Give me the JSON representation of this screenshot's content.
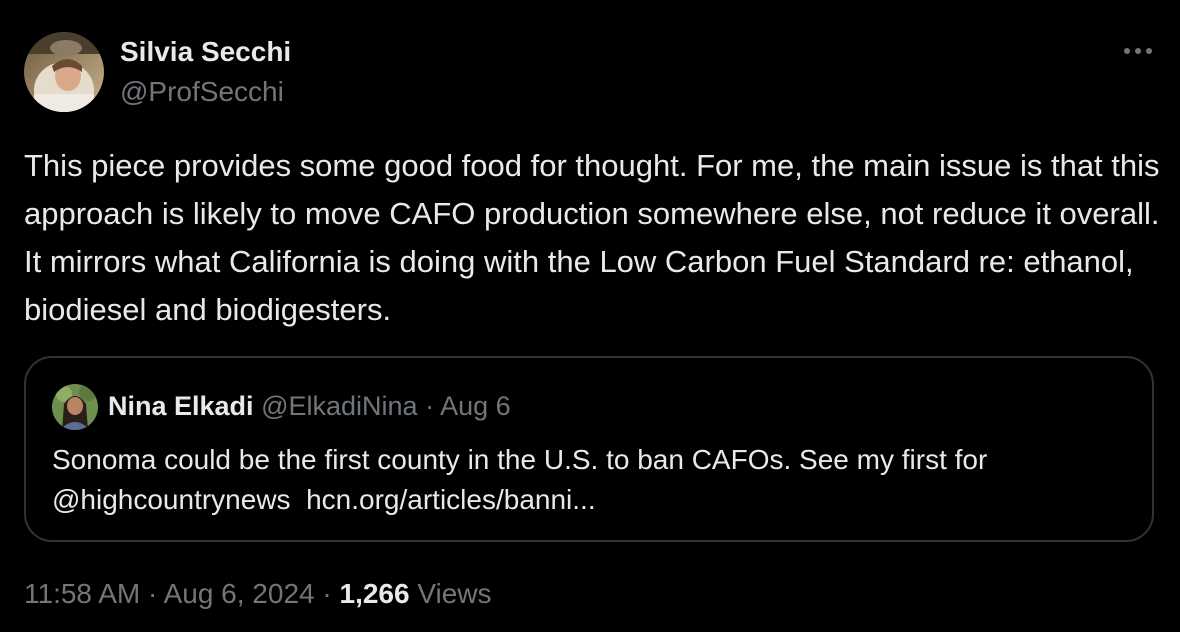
{
  "author": {
    "name": "Silvia Secchi",
    "handle": "@ProfSecchi"
  },
  "tweet": {
    "text": "This piece provides some good food for thought. For me, the main issue is that this approach is likely to move CAFO production somewhere else, not reduce it overall. It mirrors what California is doing with the Low Carbon Fuel Standard re: ethanol, biodiesel and biodigesters."
  },
  "quote": {
    "name": "Nina Elkadi",
    "handle": "@ElkadiNina",
    "separator": "·",
    "date": "Aug 6",
    "text_line1": "Sonoma could be the first county in the U.S. to ban CAFOs. See my first for",
    "mention": "@highcountrynews",
    "link": "hcn.org/articles/banni..."
  },
  "meta": {
    "time": "11:58 AM",
    "separator": "·",
    "date": "Aug 6, 2024",
    "views_count": "1,266",
    "views_label": "Views"
  },
  "icons": {
    "more": "more-horizontal-icon"
  },
  "colors": {
    "background": "#000000",
    "text_primary": "#e7e9ea",
    "text_secondary": "#71767b",
    "border": "#2f3336"
  }
}
